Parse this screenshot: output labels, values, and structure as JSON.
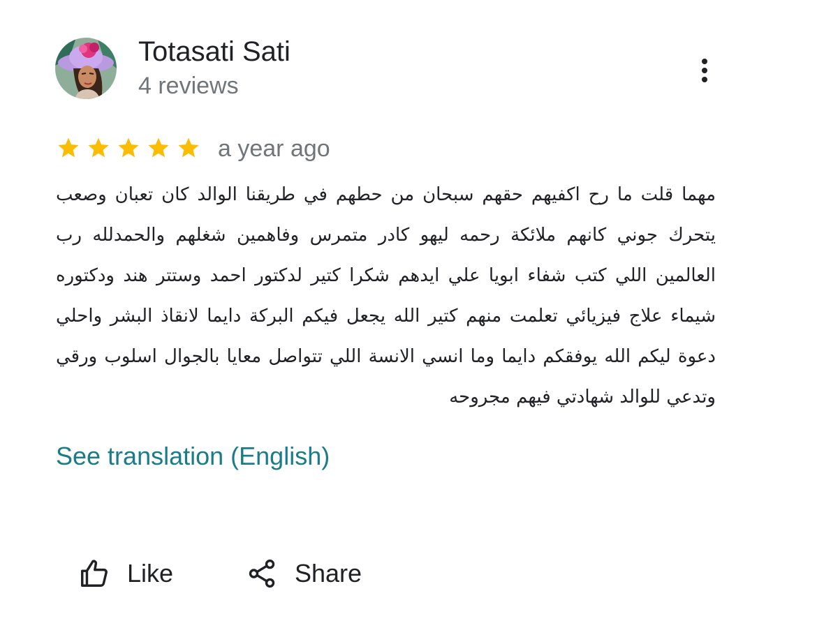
{
  "reviewer": {
    "name": "Totasati Sati",
    "review_count": "4 reviews",
    "avatar_icon": "avatar-woman-hat-icon"
  },
  "menu": {
    "icon": "more-vert-icon"
  },
  "review": {
    "rating": 5,
    "max_rating": 5,
    "star_color": "#fbbc04",
    "time": "a year ago",
    "text": "مهما قلت ما رح اكفيهم حقهم سبحان من حطهم في طريقنا الوالد كان تعبان وصعب يتحرك جوني كانهم ملائكة رحمه ليهو كادر متمرس وفاهمين شغلهم والحمدلله رب العالمين اللي كتب شفاء ابويا علي ايدهم شكرا كتير لدكتور احمد وستتر هند ودكتوره شيماء علاج فيزيائي تعلمت منهم كتير الله يجعل فيكم البركة دايما لانقاذ البشر واحلي دعوة ليكم الله يوفقكم دايما وما انسي الانسة اللي تتواصل معايا بالجوال اسلوب ورقي وتدعي للوالد شهادتي فيهم مجروحه"
  },
  "translation": {
    "label": "See translation (English)",
    "color": "#1a7c88"
  },
  "actions": {
    "like_label": "Like",
    "share_label": "Share",
    "like_icon": "thumb-up-icon",
    "share_icon": "share-icon"
  }
}
